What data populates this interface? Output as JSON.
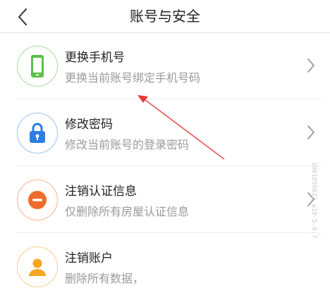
{
  "header": {
    "title": "账号与安全",
    "back_icon": "chevron-left-icon"
  },
  "items": [
    {
      "title": "更换手机号",
      "subtitle": "更换当前账号绑定手机号码",
      "icon": "phone-icon",
      "color": "#5cbf49"
    },
    {
      "title": "修改密码",
      "subtitle": "修改当前账号的登录密码",
      "icon": "lock-icon",
      "color": "#2f7de1"
    },
    {
      "title": "注销认证信息",
      "subtitle": "仅删除所有房屋认证信息",
      "icon": "minus-circle-icon",
      "color": "#f06a2b"
    },
    {
      "title": "注销账户",
      "subtitle": "删除所有数据，",
      "icon": "user-icon",
      "color": "#f5a623"
    }
  ],
  "watermark": "1001050822 a10-5.0.7",
  "annotation": {
    "arrow_color": "#e53935"
  }
}
